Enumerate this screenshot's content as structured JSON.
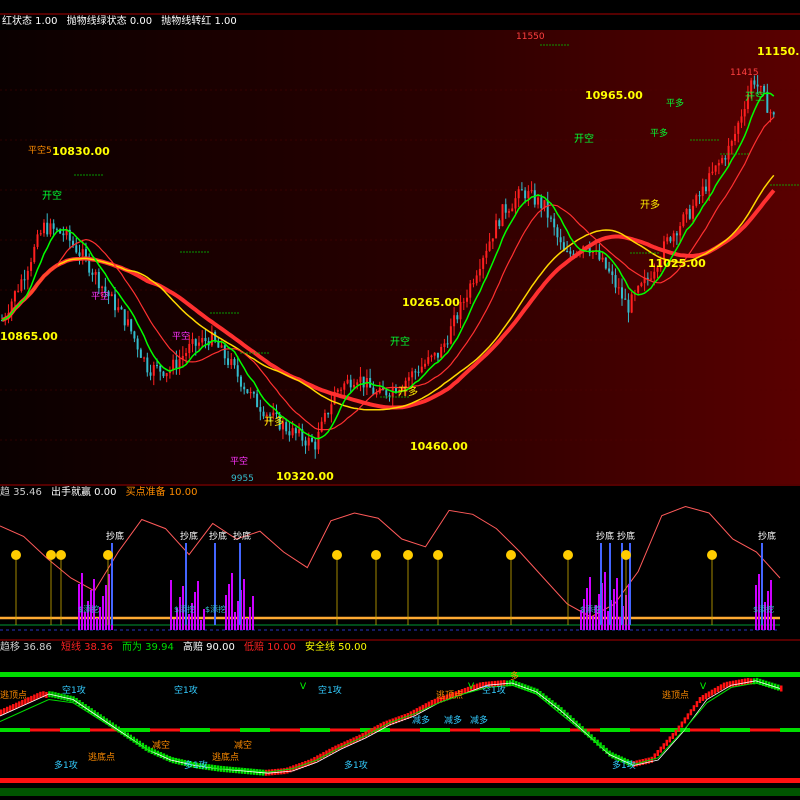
{
  "colors": {
    "background": "#000000",
    "rise": "#ff2020",
    "fall": "#33bbcc",
    "price_label": "#ffff00",
    "open_short": "#00ff33",
    "open_long": "#ffee00",
    "close_short": "#ff33ff",
    "ma_green": "#00ff00",
    "ma_red": "#ff3030",
    "ma_yellow": "#ffd700",
    "osc_line": "#ff5a5a",
    "bottom_bar": "#cc00ff",
    "panel3_green": "#00dd00",
    "panel3_red": "#ff1111"
  },
  "top_panel": {
    "header": [
      "红状态 1.00",
      "抛物线绿状态 0.00",
      "抛物线转红 1.00"
    ],
    "price_labels": [
      "11550",
      "11150.00",
      "11415",
      "10965.00",
      "10830.00",
      "10865.00",
      "10265.00",
      "11025.00",
      "10460.00",
      "10320.00",
      "9955",
      "平空5"
    ],
    "signals": {
      "open_short": "开空",
      "open_long": "开多",
      "close_short": "平空",
      "close_long": "平多"
    }
  },
  "middle_panel": {
    "header": [
      {
        "text": "趋 35.46",
        "color": "#cccccc"
      },
      {
        "text": "出手就赢 0.00",
        "color": "#ffffff"
      },
      {
        "text": "买点准备 10.00",
        "color": "#ff8c00"
      }
    ],
    "buy_bottom_label": "抄底",
    "small_label": "$添挖"
  },
  "bottom_panel": {
    "header": [
      {
        "text": "趋移 36.86",
        "color": "#cccccc"
      },
      {
        "text": "短线 38.36",
        "color": "#ff2222"
      },
      {
        "text": "而为 39.94",
        "color": "#00dd00"
      },
      {
        "text": "高赔 90.00",
        "color": "#ffffff"
      },
      {
        "text": "低赔 10.00",
        "color": "#ff2222"
      },
      {
        "text": "安全线 50.00",
        "color": "#ffff00"
      }
    ],
    "labels": {
      "empty_attack": "空1攻",
      "many_attack": "多1攻",
      "escape_top": "逃顶点",
      "escape_bottom": "逃底点",
      "reduce_long": "减多",
      "reduce_empty": "减空",
      "long": "多",
      "v": "V"
    }
  },
  "chart_data": [
    {
      "type": "candlestick",
      "panel": "main",
      "ylim": [
        9800,
        11600
      ],
      "close_path": [
        10450,
        10620,
        10820,
        10790,
        10690,
        10560,
        10440,
        10260,
        10250,
        10340,
        10380,
        10270,
        10140,
        10060,
        10000,
        9955,
        10170,
        10230,
        10150,
        10190,
        10260,
        10320,
        10500,
        10700,
        10880,
        10960,
        10900,
        10700,
        10760,
        10650,
        10500,
        10620,
        10780,
        10880,
        11020,
        11150,
        11415,
        11250
      ],
      "annotated_prices": [
        11550,
        11150,
        11415,
        10965,
        10830,
        10865,
        10265,
        11025,
        10460,
        10320,
        9955
      ]
    },
    {
      "type": "line",
      "panel": "oscillator",
      "ylim": [
        0,
        100
      ],
      "values": [
        80,
        72,
        55,
        40,
        30,
        60,
        85,
        78,
        58,
        82,
        70,
        76,
        60,
        48,
        84,
        90,
        86,
        70,
        64,
        92,
        89,
        78,
        60,
        40,
        20,
        10,
        20,
        45,
        88,
        95,
        90,
        70,
        60,
        40
      ],
      "series": [
        {
          "name": "出手就赢",
          "values": [
            0,
            0,
            0,
            0,
            0,
            0,
            0,
            0,
            0,
            0
          ]
        },
        {
          "name": "买点准备",
          "values": [
            10,
            10,
            10,
            10,
            10,
            10,
            10,
            10,
            10,
            10
          ]
        }
      ]
    },
    {
      "type": "line",
      "panel": "trend",
      "ylim": [
        0,
        100
      ],
      "series": [
        {
          "name": "趋移",
          "values": [
            60,
            70,
            80,
            75,
            60,
            45,
            30,
            20,
            15,
            12,
            10,
            8,
            10,
            18,
            30,
            40,
            52,
            60,
            72,
            80,
            88,
            90,
            82,
            65,
            45,
            25,
            15,
            20,
            45,
            75,
            88,
            92,
            85
          ]
        },
        {
          "name": "而为",
          "values": [
            55,
            65,
            75,
            72,
            58,
            44,
            30,
            22,
            16,
            12,
            11,
            9,
            12,
            20,
            32,
            42,
            54,
            62,
            72,
            80,
            86,
            88,
            80,
            62,
            44,
            26,
            16,
            22,
            46,
            72,
            86,
            90,
            84
          ]
        }
      ],
      "reference_lines": [
        {
          "name": "高赔",
          "value": 90
        },
        {
          "name": "低赔",
          "value": 10
        },
        {
          "name": "安全线",
          "value": 50
        }
      ]
    }
  ]
}
